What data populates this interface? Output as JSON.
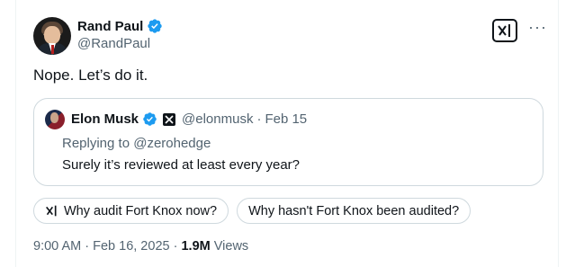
{
  "author": {
    "name": "Rand Paul",
    "handle": "@RandPaul",
    "verified_color": "#1d9bf0"
  },
  "more_label": "···",
  "tweet": {
    "text": "Nope. Let’s do it."
  },
  "quoted": {
    "name": "Elon Musk",
    "handle": "@elonmusk",
    "separator": "·",
    "date": "Feb 15",
    "replying_to": "Replying to @zerohedge",
    "text": "Surely it’s reviewed at least every year?"
  },
  "grok_prompts": [
    "Why audit Fort Knox now?",
    "Why hasn't Fort Knox been audited?"
  ],
  "meta": {
    "time": "9:00 AM",
    "sep1": "·",
    "date": "Feb 16, 2025",
    "sep2": "·",
    "views": "1.9M",
    "views_label": "Views"
  },
  "icons": [
    "verified-badge-icon",
    "grok-icon",
    "more-icon",
    "x-logo-icon"
  ]
}
